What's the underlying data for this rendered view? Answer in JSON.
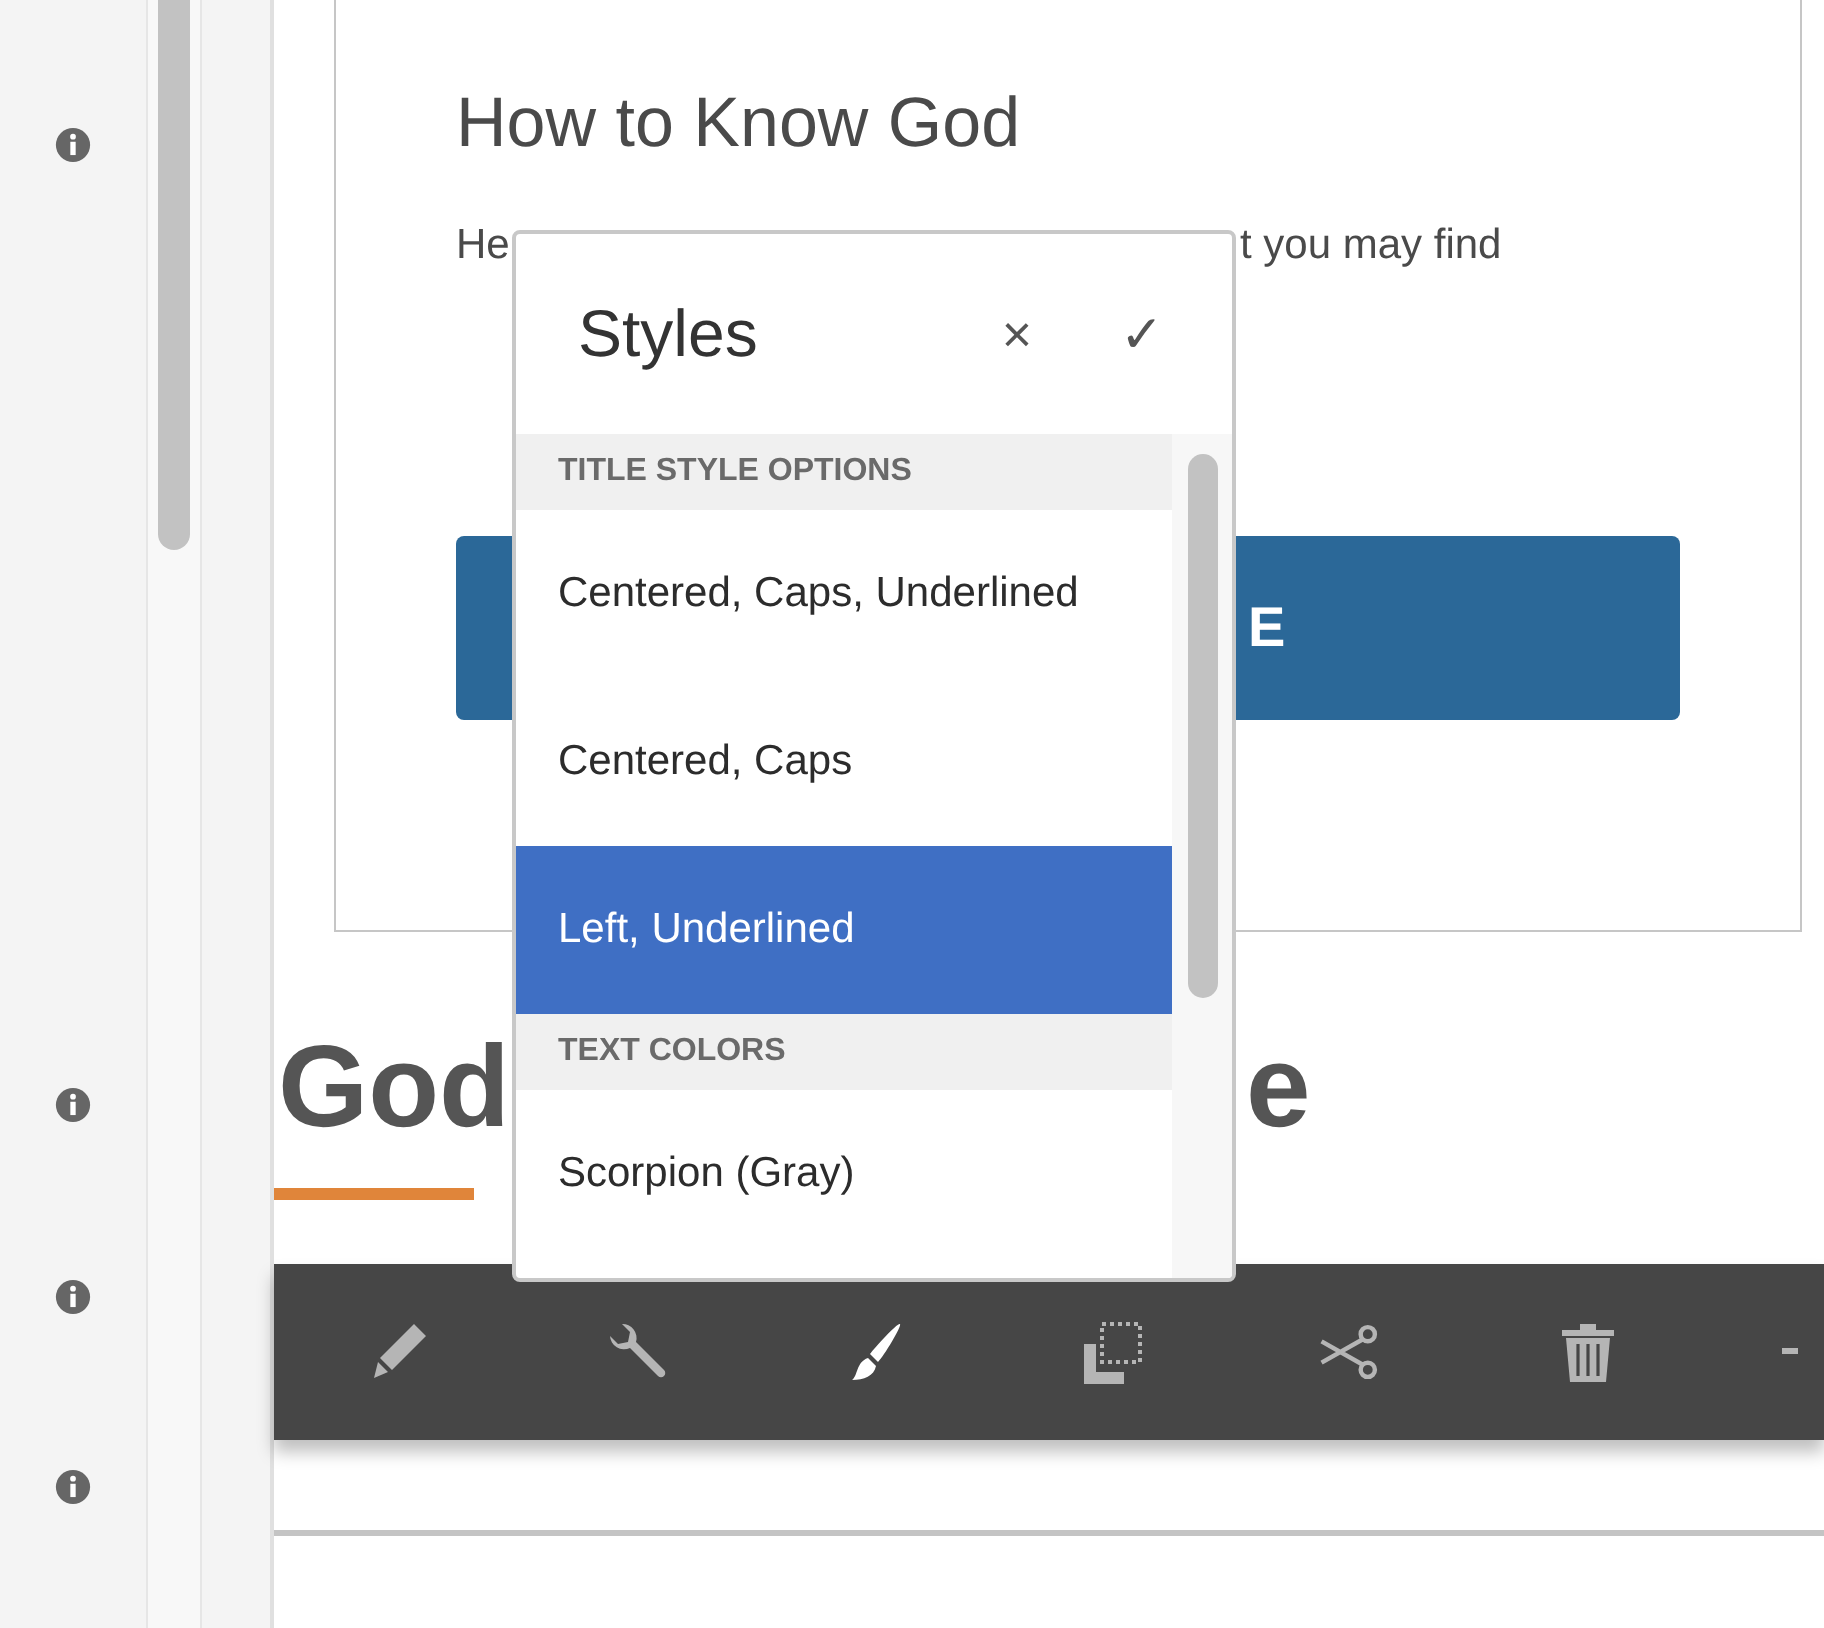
{
  "card": {
    "title": "How to Know God",
    "paragraph_fragments": [
      "He",
      "t you may find"
    ],
    "button_label_fragment": "E"
  },
  "heading_fragments": [
    "God",
    "e"
  ],
  "toolbar": {
    "tools": [
      {
        "kind": "pencil",
        "selected": false
      },
      {
        "kind": "wrench",
        "selected": false
      },
      {
        "kind": "brush",
        "selected": true
      },
      {
        "kind": "copy",
        "selected": false
      },
      {
        "kind": "scissors",
        "selected": false
      },
      {
        "kind": "trash",
        "selected": false
      },
      {
        "kind": "partial",
        "selected": false
      }
    ]
  },
  "styles_popover": {
    "title": "Styles",
    "close": "×",
    "confirm": "✓",
    "groups": [
      {
        "label": "TITLE STYLE OPTIONS",
        "items": [
          {
            "label": "Centered, Caps, Underlined",
            "selected": false
          },
          {
            "label": "Centered, Caps",
            "selected": false
          },
          {
            "label": "Left, Underlined",
            "selected": true
          }
        ]
      },
      {
        "label": "TEXT COLORS",
        "items": [
          {
            "label": "Scorpion (Gray)",
            "selected": false
          }
        ]
      }
    ]
  }
}
